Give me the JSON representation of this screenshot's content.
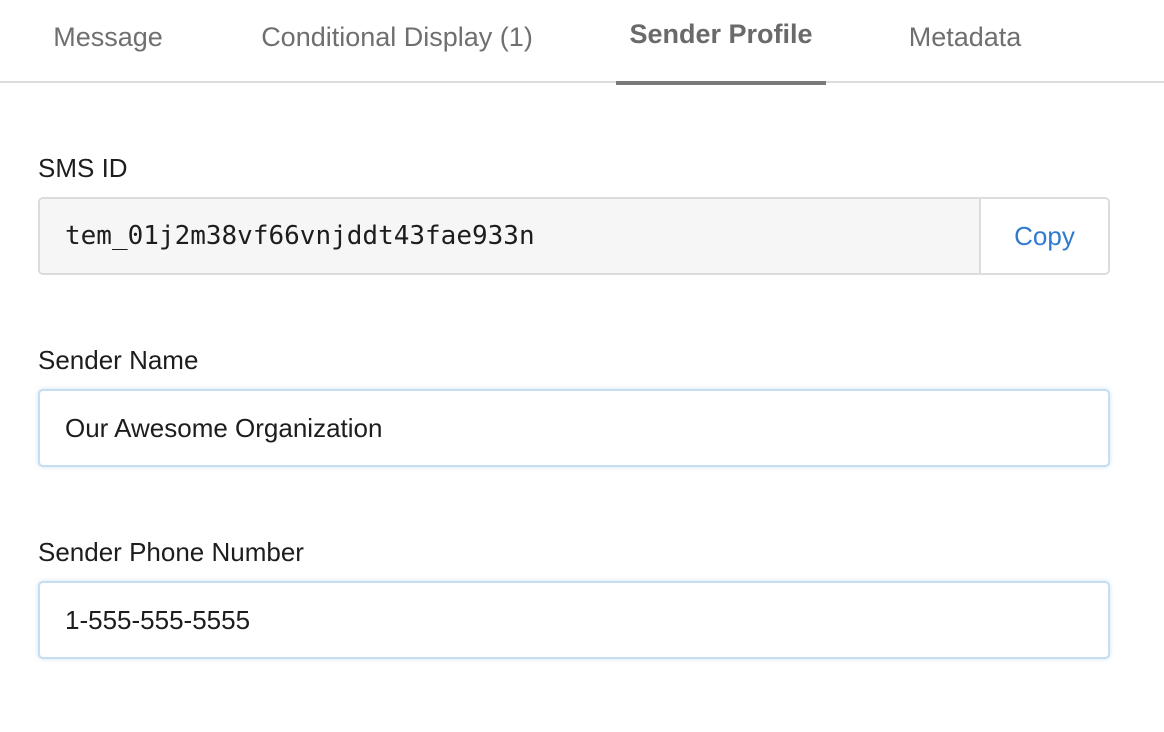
{
  "tabs": [
    {
      "label": "Message",
      "active": false
    },
    {
      "label": "Conditional Display (1)",
      "active": false
    },
    {
      "label": "Sender Profile",
      "active": true
    },
    {
      "label": "Metadata",
      "active": false
    }
  ],
  "sms_id": {
    "label": "SMS ID",
    "value": "tem_01j2m38vf66vnjddt43fae933n",
    "copy_label": "Copy"
  },
  "sender_name": {
    "label": "Sender Name",
    "value": "Our Awesome Organization"
  },
  "sender_phone": {
    "label": "Sender Phone Number",
    "value": "1-555-555-5555"
  },
  "colors": {
    "accent_link": "#2f7bd0",
    "active_tab_indicator": "#7a7a7a",
    "input_focus_border": "#c7def2"
  }
}
